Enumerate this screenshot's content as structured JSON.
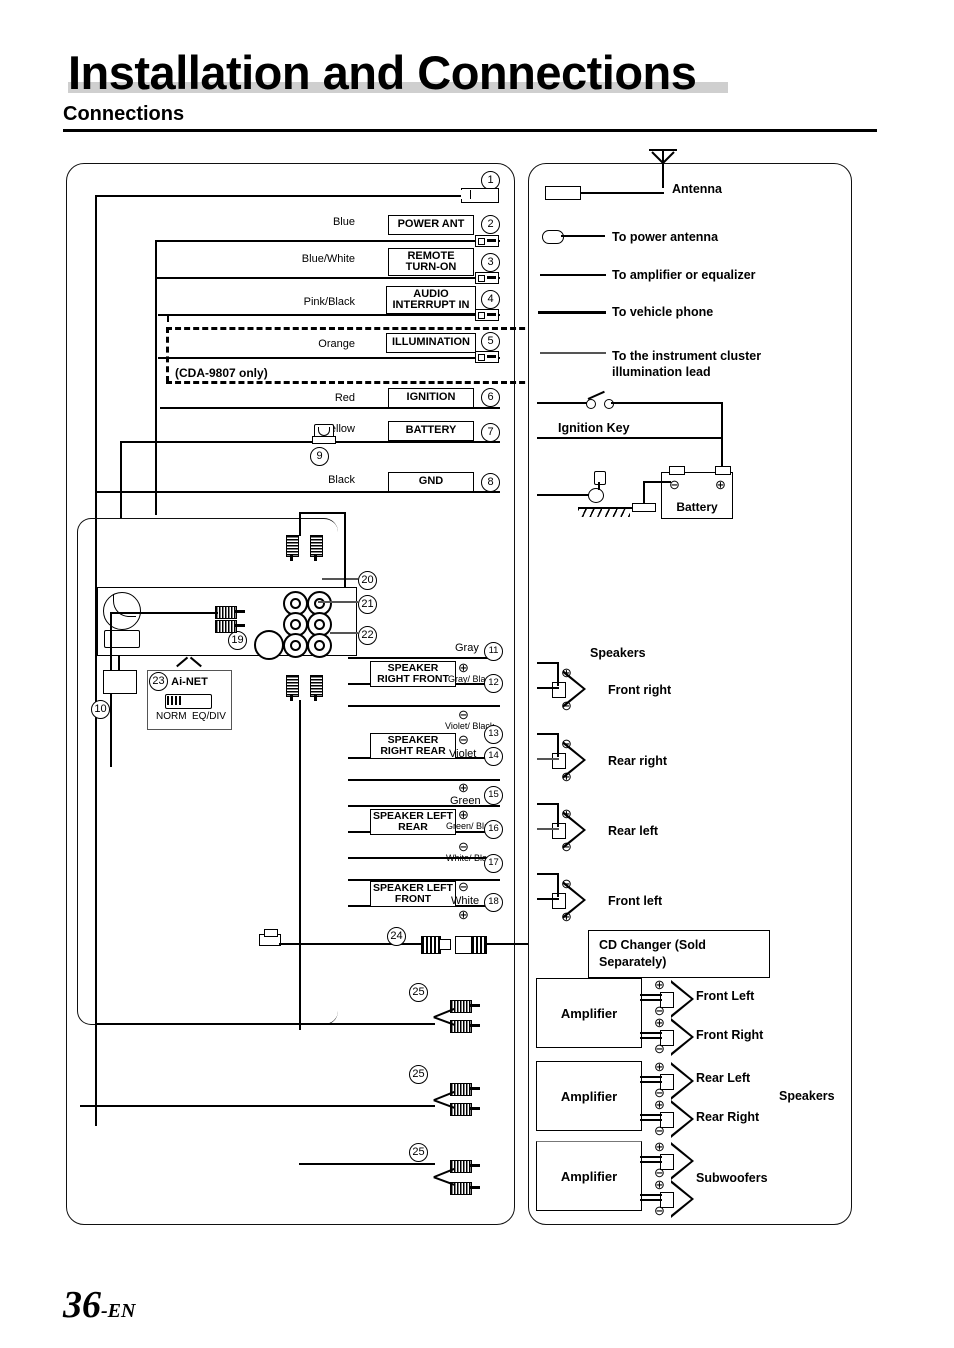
{
  "header": {
    "title": "Installation and Connections",
    "section": "Connections"
  },
  "footer": {
    "page_number": "36",
    "page_suffix": "-EN"
  },
  "left_panel": {
    "note_cda": "(CDA-9807 only)",
    "power_leads": [
      {
        "num": "1",
        "color": "",
        "label": ""
      },
      {
        "num": "2",
        "color": "Blue",
        "label": "POWER ANT"
      },
      {
        "num": "3",
        "color": "Blue/White",
        "label": "REMOTE TURN-ON"
      },
      {
        "num": "4",
        "color": "Pink/Black",
        "label": "AUDIO INTERRUPT IN"
      },
      {
        "num": "5",
        "color": "Orange",
        "label": "ILLUMINATION"
      },
      {
        "num": "6",
        "color": "Red",
        "label": "IGNITION"
      },
      {
        "num": "7",
        "color": "Yellow",
        "label": "BATTERY"
      },
      {
        "num": "8",
        "color": "Black",
        "label": "GND"
      }
    ],
    "fuse_num": "9",
    "item10_num": "10",
    "ainet": {
      "num": "23",
      "title": "Ai-NET",
      "pos_left": "NORM",
      "pos_right": "EQ/DIV"
    },
    "jack_nums": {
      "j19": "19",
      "j20": "20",
      "j21": "21",
      "j22": "22"
    },
    "speaker_leads": [
      {
        "num": "11",
        "polarity": "⊕",
        "color": "Gray"
      },
      {
        "num": "12",
        "polarity": "⊕",
        "color": "Gray/ Black",
        "box": "SPEAKER RIGHT FRONT"
      },
      {
        "num": "13",
        "polarity": "⊖",
        "color": "Violet/ Black"
      },
      {
        "num": "14",
        "polarity": "⊖",
        "color": "Violet",
        "box": "SPEAKER RIGHT REAR"
      },
      {
        "num": "15",
        "polarity": "⊕",
        "color": "Green"
      },
      {
        "num": "16",
        "polarity": "⊕",
        "color": "Green/ Black",
        "box": "SPEAKER LEFT REAR"
      },
      {
        "num": "17",
        "polarity": "⊖",
        "color": "White/ Black"
      },
      {
        "num": "18",
        "polarity": "⊖",
        "color": "White",
        "box": "SPEAKER LEFT FRONT"
      }
    ],
    "changer_cable_num": "24",
    "rca_cable_nums": [
      "25",
      "25",
      "25"
    ]
  },
  "right_panel": {
    "antenna": "Antenna",
    "to_power_antenna": "To power antenna",
    "to_amplifier": "To amplifier or equalizer",
    "to_vehicle_phone": "To vehicle phone",
    "to_instrument_cluster": "To the instrument cluster illumination lead",
    "ignition_key": "Ignition Key",
    "battery": "Battery",
    "speakers_heading": "Speakers",
    "speakers": [
      "Front right",
      "Rear right",
      "Rear left",
      "Front left"
    ],
    "cd_changer": "CD Changer (Sold Separately)",
    "amplifiers": [
      {
        "label": "Amplifier",
        "outputs": [
          "Front Left",
          "Front Right"
        ]
      },
      {
        "label": "Amplifier",
        "outputs": [
          "Rear Left",
          "Rear Right"
        ]
      },
      {
        "label": "Amplifier",
        "outputs": [
          "Subwoofers",
          ""
        ]
      }
    ],
    "amp_speakers_heading": "Speakers",
    "polarity_plus": "⊕",
    "polarity_minus": "⊖"
  },
  "colors": {
    "rule": "#cfcfcf",
    "ink": "#000000"
  }
}
